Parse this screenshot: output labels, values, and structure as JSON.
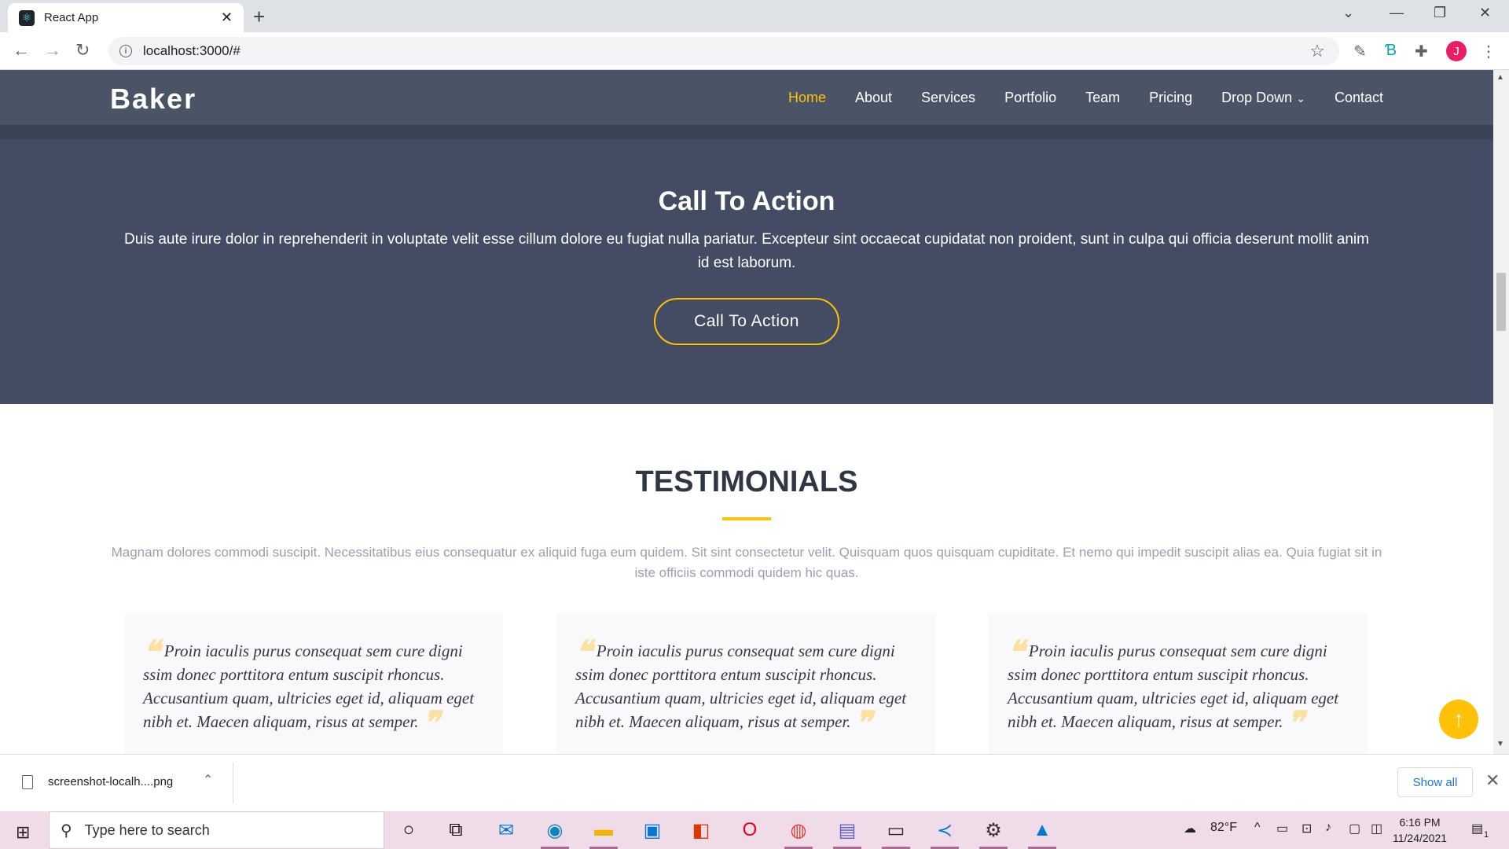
{
  "browser": {
    "tab_title": "React App",
    "url": "localhost:3000/#"
  },
  "site": {
    "logo": "Baker",
    "menu": [
      "Home",
      "About",
      "Services",
      "Portfolio",
      "Team",
      "Pricing",
      "Drop Down",
      "Contact"
    ],
    "active_menu": "Home"
  },
  "cta": {
    "title": "Call To Action",
    "text": "Duis aute irure dolor in reprehenderit in voluptate velit esse cillum dolore eu fugiat nulla pariatur. Excepteur sint occaecat cupidatat non proident, sunt in culpa qui officia deserunt mollit anim id est laborum.",
    "button": "Call To Action"
  },
  "testimonials": {
    "title": "TESTIMONIALS",
    "description": "Magnam dolores commodi suscipit. Necessitatibus eius consequatur ex aliquid fuga eum quidem. Sit sint consectetur velit. Quisquam quos quisquam cupiditate. Et nemo qui impedit suscipit alias ea. Quia fugiat sit in iste officiis commodi quidem hic quas.",
    "cards": [
      {
        "text": "Proin iaculis purus consequat sem cure digni ssim donec porttitora entum suscipit rhoncus. Accusantium quam, ultricies eget id, aliquam eget nibh et. Maecen aliquam, risus at semper."
      },
      {
        "text": "Proin iaculis purus consequat sem cure digni ssim donec porttitora entum suscipit rhoncus. Accusantium quam, ultricies eget id, aliquam eget nibh et. Maecen aliquam, risus at semper."
      },
      {
        "text": "Proin iaculis purus consequat sem cure digni ssim donec porttitora entum suscipit rhoncus. Accusantium quam, ultricies eget id, aliquam eget nibh et. Maecen aliquam, risus at semper."
      }
    ]
  },
  "download": {
    "file_name": "screenshot-localh....png",
    "show_all": "Show all"
  },
  "taskbar": {
    "search_placeholder": "Type here to search",
    "weather": "82°F",
    "time": "6:16 PM",
    "date": "11/24/2021",
    "notification_count": "1"
  },
  "colors": {
    "accent": "#ffc107",
    "header": "#4b5466",
    "cta_bg": "#434c63"
  }
}
